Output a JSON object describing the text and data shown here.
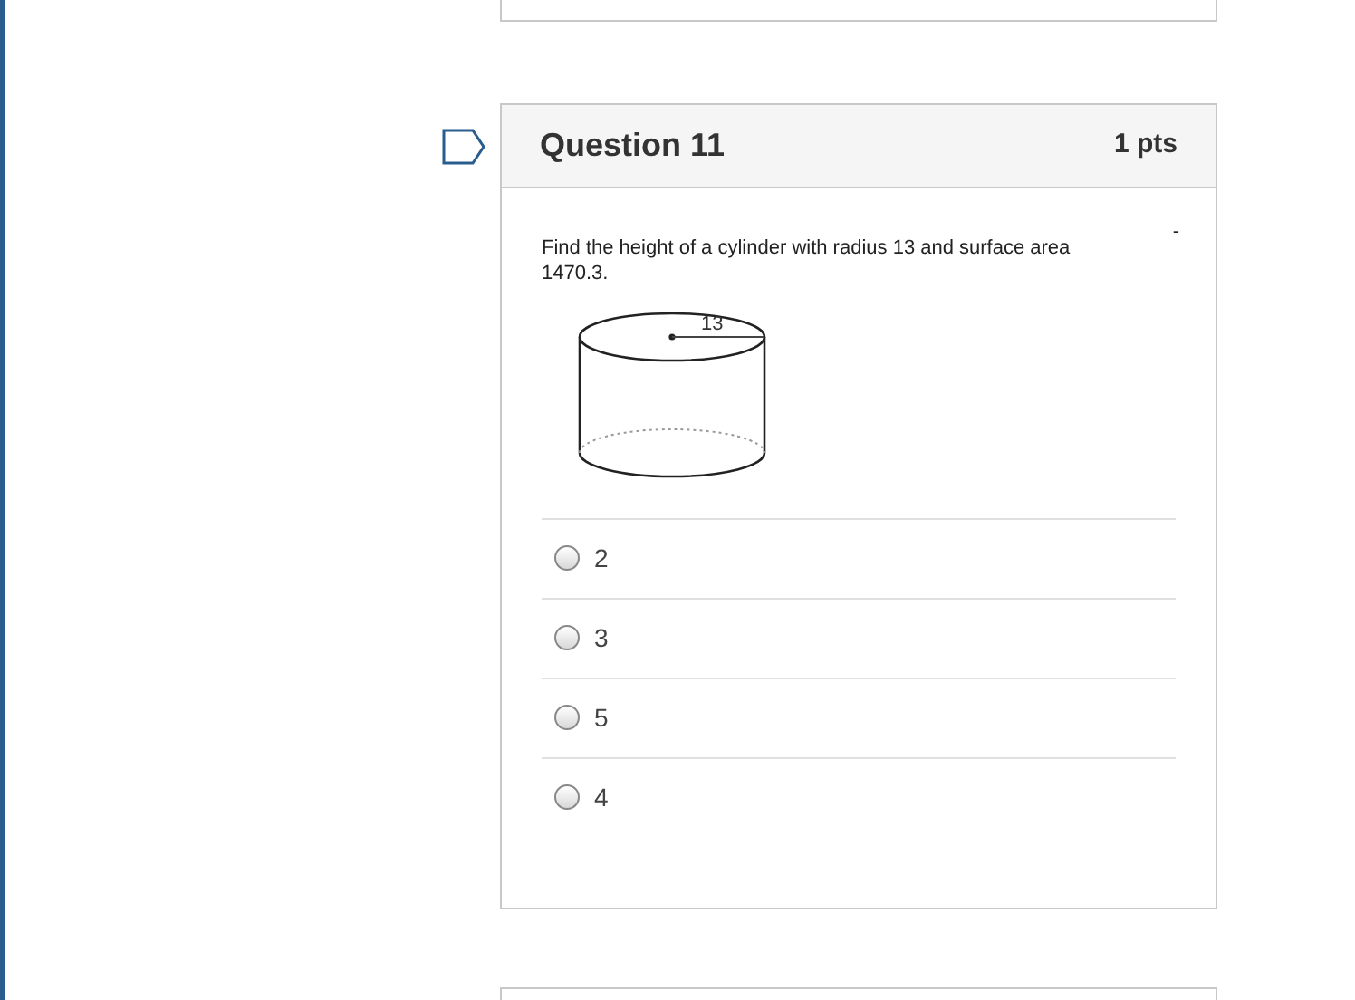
{
  "question": {
    "title": "Question 11",
    "points": "1 pts",
    "flagged": false,
    "text": "Find the height of a cylinder with radius 13 and surface area 1470.3.",
    "corner_mark": "-",
    "figure": {
      "radius_label": "13"
    },
    "options": [
      {
        "label": "2",
        "selected": false
      },
      {
        "label": "3",
        "selected": false
      },
      {
        "label": "5",
        "selected": false
      },
      {
        "label": "4",
        "selected": false
      }
    ]
  }
}
